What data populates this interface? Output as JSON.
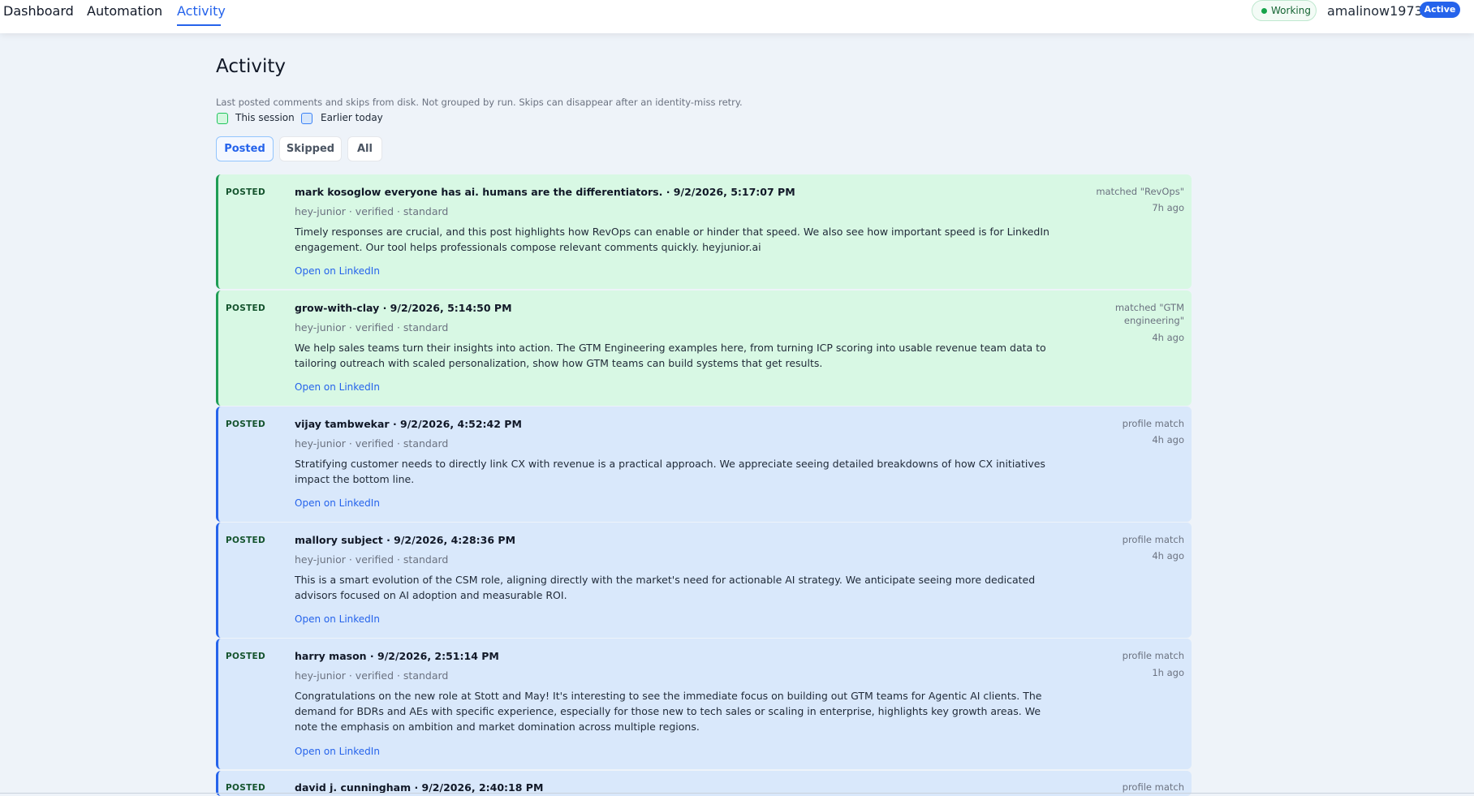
{
  "nav": {
    "tabs": [
      {
        "label": "Dashboard"
      },
      {
        "label": "Automation"
      },
      {
        "label": "Activity",
        "active": true
      }
    ],
    "status": "Working",
    "username": "amalinow1973",
    "badge": "Active"
  },
  "page": {
    "title": "Activity",
    "subtitle": "Last posted comments and skips from disk. Not grouped by run. Skips can disappear after an identity-miss retry.",
    "legend": [
      {
        "label": "This session",
        "color": "#22c55e"
      },
      {
        "label": "Earlier today",
        "color": "#3b82f6"
      }
    ],
    "filters": [
      {
        "label": "Posted",
        "active": true
      },
      {
        "label": "Skipped"
      },
      {
        "label": "All"
      }
    ]
  },
  "colors": {
    "accent": "#2563eb",
    "session_bg": "#d8f8e4",
    "earlier_bg": "#d9e8fb",
    "posted_green": "#16a34a"
  },
  "activity": [
    {
      "status": "POSTED",
      "title": "mark kosoglow everyone has ai. humans are the differentiators. · 9/2/2026, 5:17:07 PM",
      "meta": "hey-junior · verified · standard",
      "body": "Timely responses are crucial, and this post highlights how RevOps can enable or hinder that speed. We also see how important speed is for LinkedIn engagement. Our tool helps professionals compose relevant comments quickly. heyjunior.ai",
      "link": "Open on LinkedIn",
      "match": "matched \"RevOps\"",
      "time": "7h ago",
      "group": "This session"
    },
    {
      "status": "POSTED",
      "title": "grow-with-clay · 9/2/2026, 5:14:50 PM",
      "meta": "hey-junior · verified · standard",
      "body": "We help sales teams turn their insights into action. The GTM Engineering examples here, from turning ICP scoring into usable revenue team data to tailoring outreach with scaled personalization, show how GTM teams can build systems that get results.",
      "link": "Open on LinkedIn",
      "match": "matched \"GTM engineering\"",
      "time": "4h ago",
      "group": "This session"
    },
    {
      "status": "POSTED",
      "title": "vijay tambwekar · 9/2/2026, 4:52:42 PM",
      "meta": "hey-junior · verified · standard",
      "body": "Stratifying customer needs to directly link CX with revenue is a practical approach. We appreciate seeing detailed breakdowns of how CX initiatives impact the bottom line.",
      "link": "Open on LinkedIn",
      "match": "profile match",
      "time": "4h ago",
      "group": "Earlier today"
    },
    {
      "status": "POSTED",
      "title": "mallory subject · 9/2/2026, 4:28:36 PM",
      "meta": "hey-junior · verified · standard",
      "body": "This is a smart evolution of the CSM role, aligning directly with the market's need for actionable AI strategy. We anticipate seeing more dedicated advisors focused on AI adoption and measurable ROI.",
      "link": "Open on LinkedIn",
      "match": "profile match",
      "time": "4h ago",
      "group": "Earlier today"
    },
    {
      "status": "POSTED",
      "title": "harry mason · 9/2/2026, 2:51:14 PM",
      "meta": "hey-junior · verified · standard",
      "body": "Congratulations on the new role at Stott and May! It's interesting to see the immediate focus on building out GTM teams for Agentic AI clients. The demand for BDRs and AEs with specific experience, especially for those new to tech sales or scaling in enterprise, highlights key growth areas. We note the emphasis on ambition and market domination across multiple regions.",
      "link": "Open on LinkedIn",
      "match": "profile match",
      "time": "1h ago",
      "group": "Earlier today"
    },
    {
      "status": "POSTED",
      "title": "david j. cunningham · 9/2/2026, 2:40:18 PM",
      "match": "profile match",
      "group": "Earlier today"
    }
  ]
}
